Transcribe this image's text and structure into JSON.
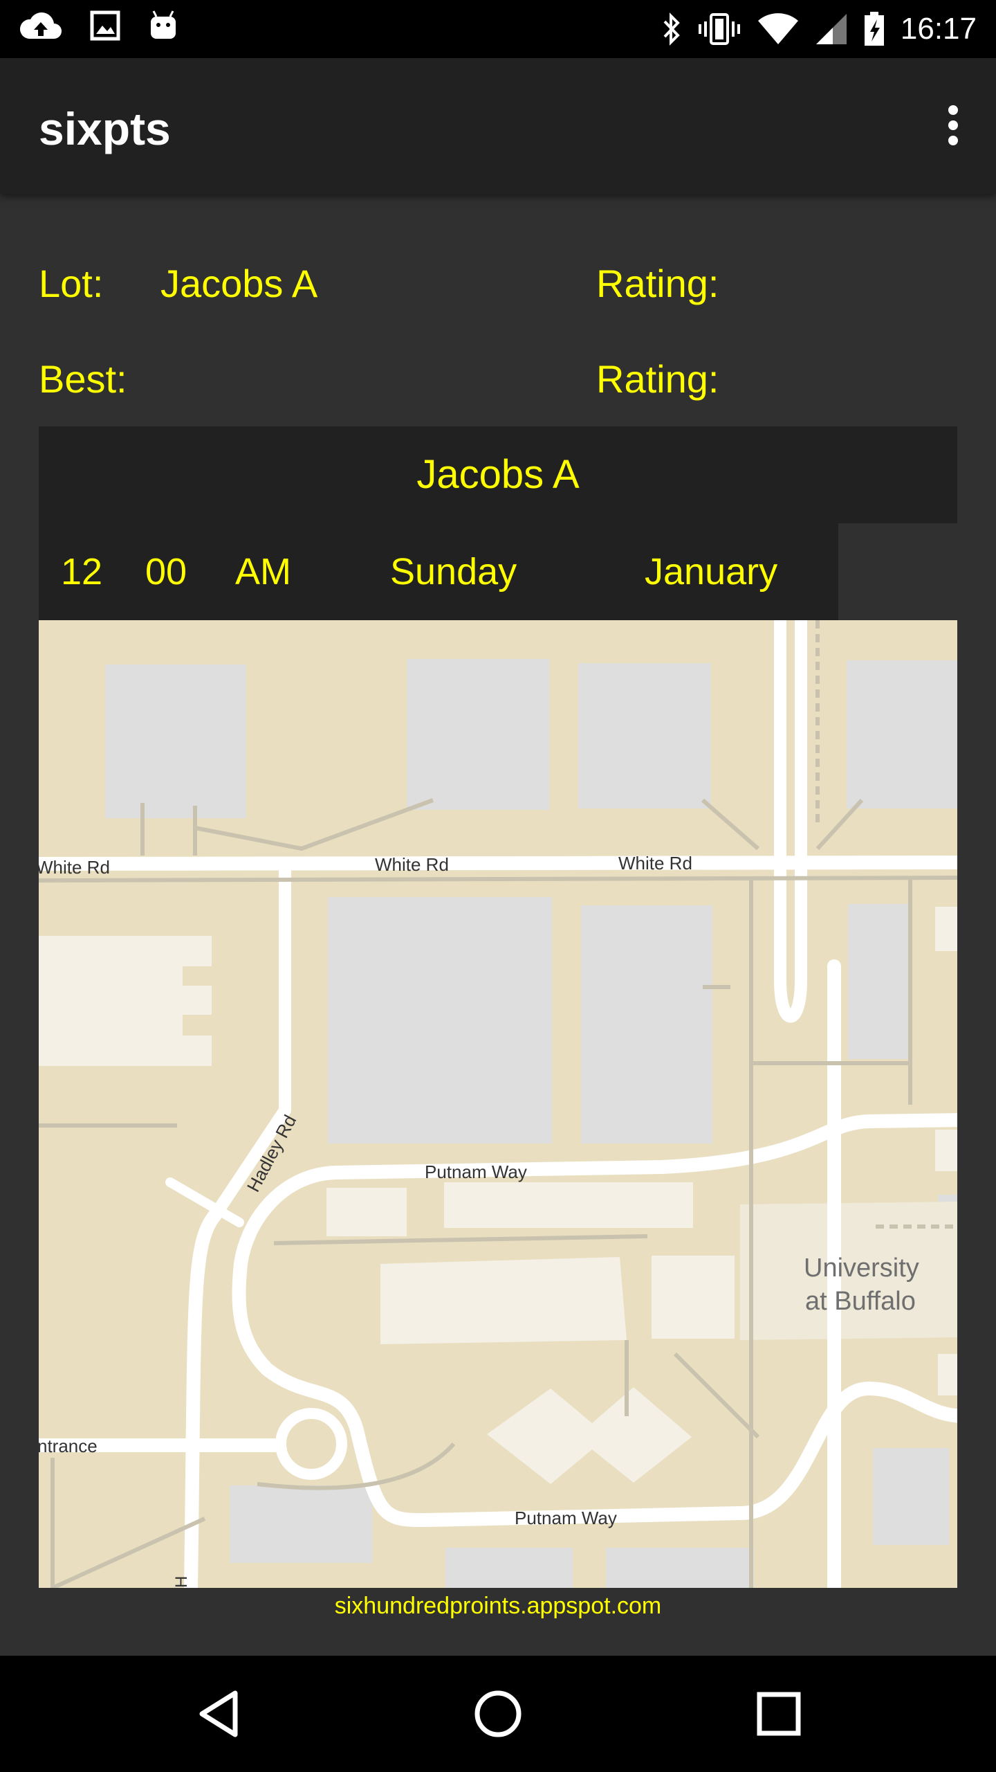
{
  "status_bar": {
    "time": "16:17",
    "left_icons": [
      "cloud-upload-icon",
      "image-icon",
      "android-icon"
    ],
    "right_icons": [
      "bluetooth-icon",
      "vibrate-icon",
      "wifi-icon",
      "cell-signal-icon",
      "battery-icon"
    ]
  },
  "app_bar": {
    "title": "sixpts",
    "menu_icon": "overflow-menu-icon"
  },
  "info": {
    "lot_label": "Lot:",
    "lot_value": "Jacobs A",
    "rating_label_1": "Rating:",
    "best_label": "Best:",
    "rating_label_2": "Rating:"
  },
  "selector": {
    "title": "Jacobs A",
    "hour": "12",
    "minute": "00",
    "ampm": "AM",
    "day": "Sunday",
    "month": "January"
  },
  "map": {
    "labels": {
      "white_rd_left": "White Rd",
      "white_rd_mid": "White Rd",
      "white_rd_right": "White Rd",
      "hadley_rd": "Hadley Rd",
      "putnam_way_top": "Putnam Way",
      "putnam_way_bottom": "Putnam Way",
      "university_line1": "University",
      "university_line2": "at Buffalo",
      "entrance": "ntrance",
      "h_label": "H"
    },
    "colors": {
      "land": "#e9dfc0",
      "road": "#ffffff",
      "parking": "#dedede",
      "building": "#f4f0e6"
    }
  },
  "footer": {
    "link": "sixhundredproints.appspot.com"
  },
  "nav": {
    "back": "back-icon",
    "home": "home-icon",
    "recents": "recents-icon"
  },
  "colors": {
    "accent_text": "#ffff00",
    "app_bar": "#212121",
    "background": "#303030"
  }
}
